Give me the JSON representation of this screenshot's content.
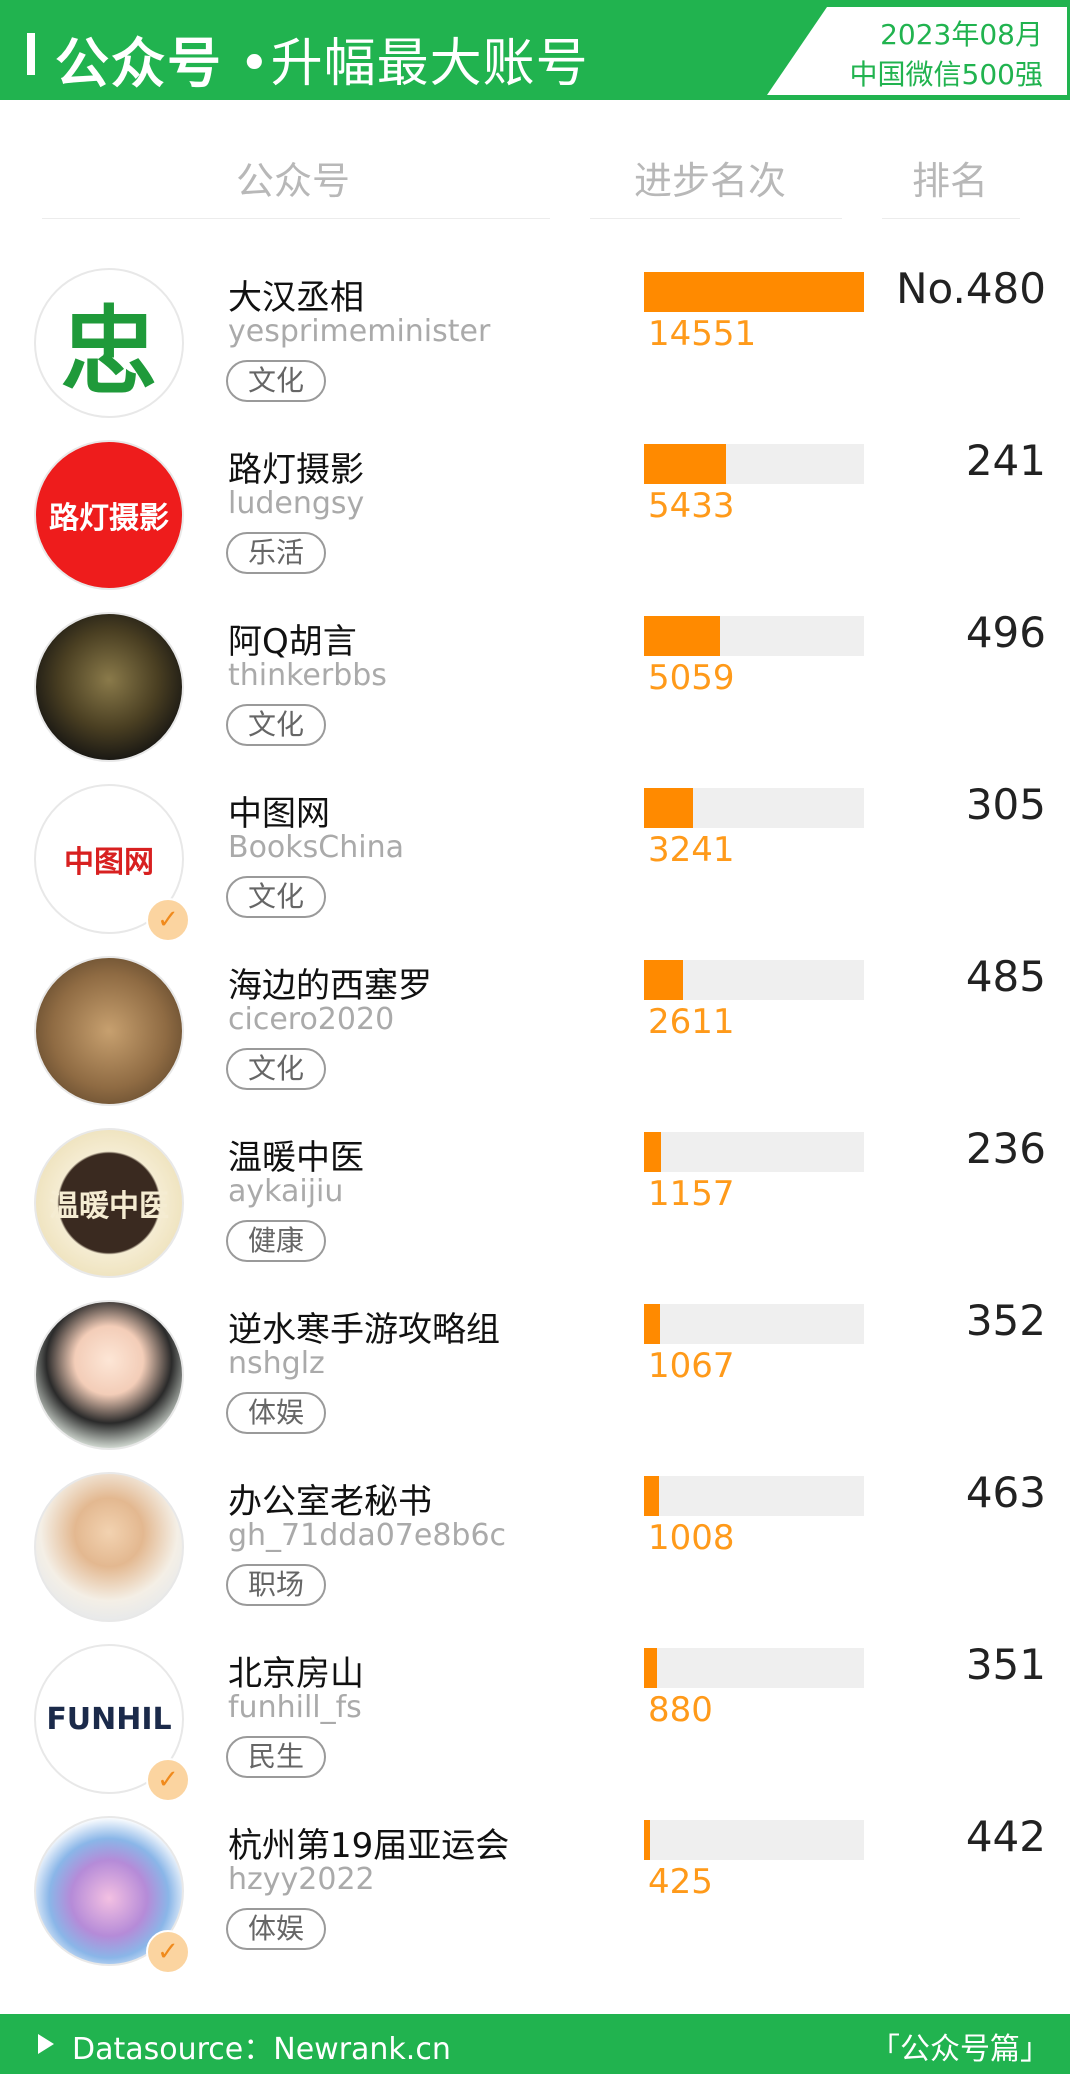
{
  "header": {
    "title_main": "公众号",
    "title_sub": "•升幅最大账号",
    "date": "2023年08月",
    "subtitle": "中国微信500强"
  },
  "columns": {
    "account": "公众号",
    "progress": "进步名次",
    "rank": "排名"
  },
  "accent_colors": {
    "brand_green": "#21b34f",
    "bar_orange": "#ff8a00"
  },
  "chart_data": {
    "type": "bar",
    "title": "升幅最大账号",
    "xlabel": "",
    "ylabel": "进步名次",
    "ylim": [
      0,
      14551
    ],
    "categories": [
      "大汉丞相",
      "路灯摄影",
      "阿Q胡言",
      "中图网",
      "海边的西塞罗",
      "温暖中医",
      "逆水寒手游攻略组",
      "办公室老秘书",
      "北京房山",
      "杭州第19届亚运会"
    ],
    "values": [
      14551,
      5433,
      5059,
      3241,
      2611,
      1157,
      1067,
      1008,
      880,
      425
    ]
  },
  "accounts": [
    {
      "name": "大汉丞相",
      "handle": "yesprimeminister",
      "tag": "文化",
      "progress": 14551,
      "rank": "No.480",
      "avatar_text": "忠",
      "avatar_style": "green",
      "verified": false
    },
    {
      "name": "路灯摄影",
      "handle": "ludengsy",
      "tag": "乐活",
      "progress": 5433,
      "rank": "241",
      "avatar_text": "路灯摄影",
      "avatar_style": "red",
      "verified": false
    },
    {
      "name": "阿Q胡言",
      "handle": "thinkerbbs",
      "tag": "文化",
      "progress": 5059,
      "rank": "496",
      "avatar_text": "",
      "avatar_style": "dark",
      "verified": false
    },
    {
      "name": "中图网",
      "handle": "BooksChina",
      "tag": "文化",
      "progress": 3241,
      "rank": "305",
      "avatar_text": "中图网",
      "avatar_style": "booksc",
      "verified": true
    },
    {
      "name": "海边的西塞罗",
      "handle": "cicero2020",
      "tag": "文化",
      "progress": 2611,
      "rank": "485",
      "avatar_text": "",
      "avatar_style": "painting",
      "verified": false
    },
    {
      "name": "温暖中医",
      "handle": "aykaijiu",
      "tag": "健康",
      "progress": 1157,
      "rank": "236",
      "avatar_text": "温暖中医",
      "avatar_style": "tcm",
      "verified": false
    },
    {
      "name": "逆水寒手游攻略组",
      "handle": "nshglz",
      "tag": "体娱",
      "progress": 1067,
      "rank": "352",
      "avatar_text": "",
      "avatar_style": "anime",
      "verified": false
    },
    {
      "name": "办公室老秘书",
      "handle": "gh_71dda07e8b6c",
      "tag": "职场",
      "progress": 1008,
      "rank": "463",
      "avatar_text": "",
      "avatar_style": "cartoon",
      "verified": false
    },
    {
      "name": "北京房山",
      "handle": "funhill_fs",
      "tag": "民生",
      "progress": 880,
      "rank": "351",
      "avatar_text": "FUNHIL",
      "avatar_style": "funhill",
      "verified": true
    },
    {
      "name": "杭州第19届亚运会",
      "handle": "hzyy2022",
      "tag": "体娱",
      "progress": 425,
      "rank": "442",
      "avatar_text": "",
      "avatar_style": "asian",
      "verified": true
    }
  ],
  "footer": {
    "source": "Datasource：Newrank.cn",
    "category": "「公众号篇」"
  }
}
